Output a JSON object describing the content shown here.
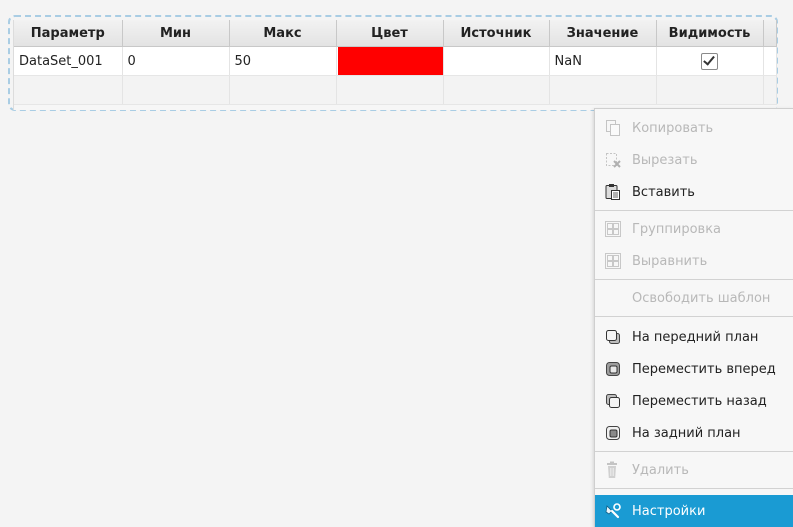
{
  "table": {
    "columns": [
      "Параметр",
      "Мин",
      "Макс",
      "Цвет",
      "Источник",
      "Значение",
      "Видимость"
    ],
    "rows": [
      {
        "parameter": "DataSet_001",
        "min": "0",
        "max": "50",
        "color": "#ff0000",
        "source": "",
        "value": "NaN",
        "visible": true
      }
    ]
  },
  "context_menu": {
    "items": [
      {
        "label": "Копировать",
        "icon": "copy-icon",
        "enabled": false
      },
      {
        "label": "Вырезать",
        "icon": "cut-icon",
        "enabled": false
      },
      {
        "label": "Вставить",
        "icon": "paste-icon",
        "enabled": true
      },
      {
        "label": "Группировка",
        "icon": "group-icon",
        "enabled": false
      },
      {
        "label": "Выравнить",
        "icon": "align-icon",
        "enabled": false
      },
      {
        "label": "Освободить шаблон",
        "icon": "",
        "enabled": false
      },
      {
        "label": "На передний план",
        "icon": "bring-to-front-icon",
        "enabled": true
      },
      {
        "label": "Переместить вперед",
        "icon": "bring-forward-icon",
        "enabled": true
      },
      {
        "label": "Переместить назад",
        "icon": "send-backward-icon",
        "enabled": true
      },
      {
        "label": "На задний план",
        "icon": "send-to-back-icon",
        "enabled": true
      },
      {
        "label": "Удалить",
        "icon": "trash-icon",
        "enabled": false
      },
      {
        "label": "Настройки",
        "icon": "settings-icon",
        "enabled": true,
        "highlighted": true
      }
    ]
  },
  "colors": {
    "highlight": "#1a9bd3",
    "selection_frame": "#a9cde4",
    "disabled_text": "#b8b8b8"
  }
}
